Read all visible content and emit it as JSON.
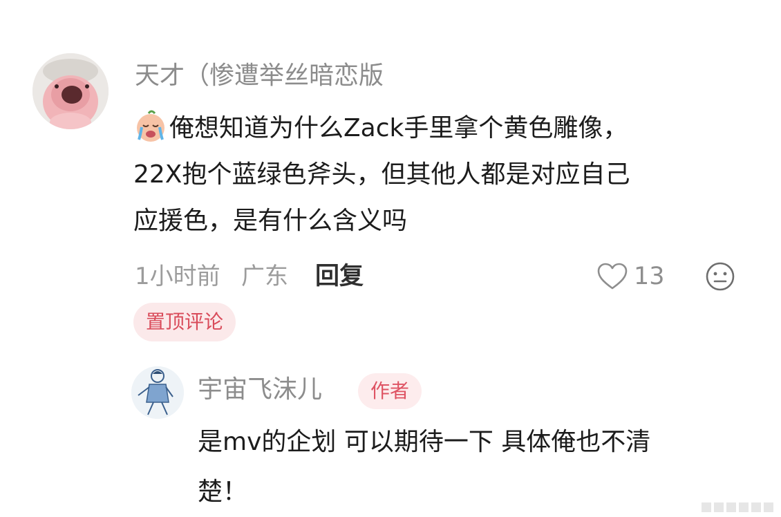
{
  "main_comment": {
    "username": "天才（惨遭举丝暗恋版",
    "text_lines": [
      "俺想知道为什么Zack手里拿个黄色雕像，",
      "22X抱个蓝绿色斧头，但其他人都是对应自己",
      "应援色，是有什么含义吗"
    ],
    "time": "1小时前",
    "location": "广东",
    "reply_label": "回复",
    "like_count": "13",
    "pinned_label": "置顶评论"
  },
  "reply": {
    "username": "宇宙飞沫儿",
    "author_badge": "作者",
    "text_lines": [
      "是mv的企划 可以期待一下 具体俺也不清",
      "楚！"
    ]
  },
  "colors": {
    "pinned_badge_text": "#d94b5a",
    "pinned_badge_bg": "#fbe9ea"
  }
}
